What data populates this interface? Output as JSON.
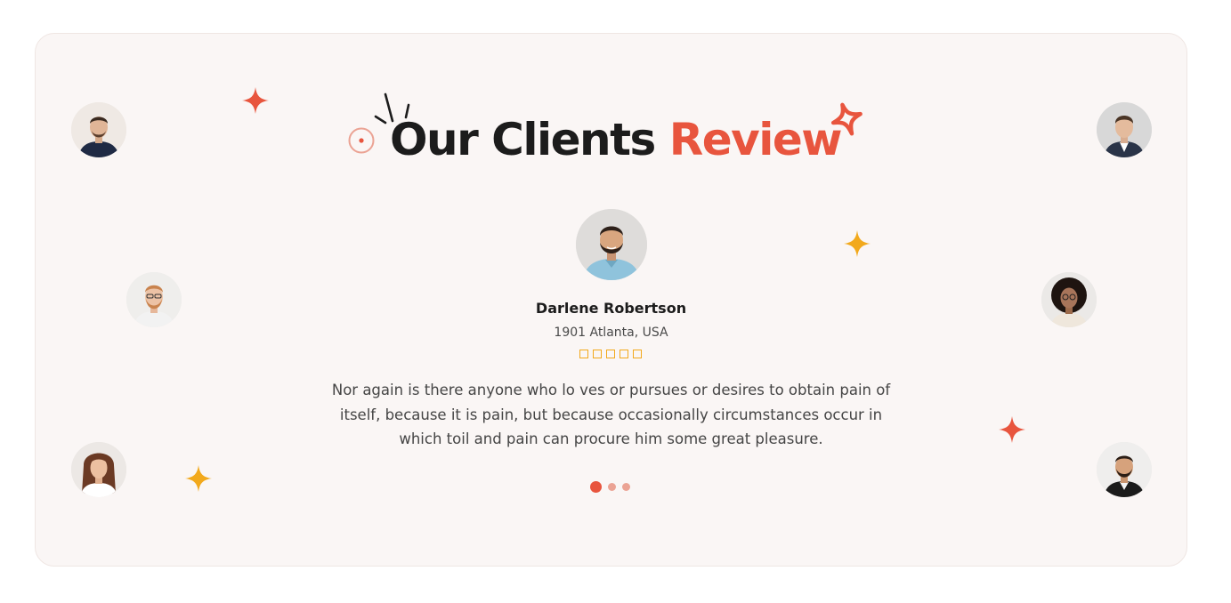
{
  "section": {
    "title_main": "Our Clients",
    "title_accent": "Review"
  },
  "testimonial": {
    "name": "Darlene Robertson",
    "location": "1901 Atlanta, USA",
    "rating": 5,
    "quote": "Nor again is there anyone who lo ves or pursues or desires to obtain pain of itself, because it is pain, but because occasionally circumstances occur in which toil and pain can procure him some great pleasure."
  },
  "pagination": {
    "count": 3,
    "active_index": 0
  },
  "colors": {
    "accent": "#e8553e",
    "star": "#f2a91c",
    "card_background": "#faf6f5",
    "text_dark": "#1c1c1c"
  }
}
